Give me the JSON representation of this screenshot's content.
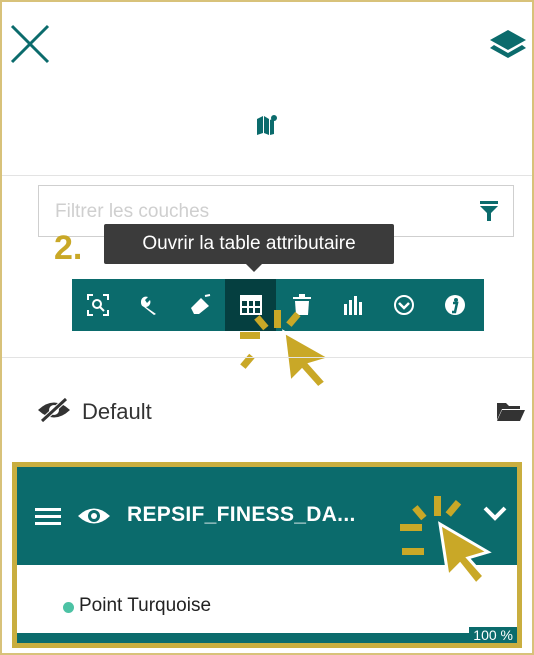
{
  "filter": {
    "placeholder": "Filtrer les couches"
  },
  "step": {
    "label": "2."
  },
  "tooltip": {
    "text": "Ouvrir la table attributaire"
  },
  "toolbar": {
    "buttons": [
      {
        "icon": "zoom-extent-icon"
      },
      {
        "icon": "wrench-icon"
      },
      {
        "icon": "eraser-icon"
      },
      {
        "icon": "table-icon",
        "active": true
      },
      {
        "icon": "trash-icon"
      },
      {
        "icon": "bar-chart-icon"
      },
      {
        "icon": "download-circle-icon"
      },
      {
        "icon": "info-icon"
      }
    ]
  },
  "group": {
    "label": "Default"
  },
  "layer": {
    "title": "REPSIF_FINESS_DA...",
    "legend_label": "Point Turquoise",
    "opacity": "100 %"
  },
  "colors": {
    "teal": "#0b6b6c",
    "dark_teal": "#053f40",
    "gold": "#c9a827",
    "legend_dot": "#4cc2a4"
  }
}
